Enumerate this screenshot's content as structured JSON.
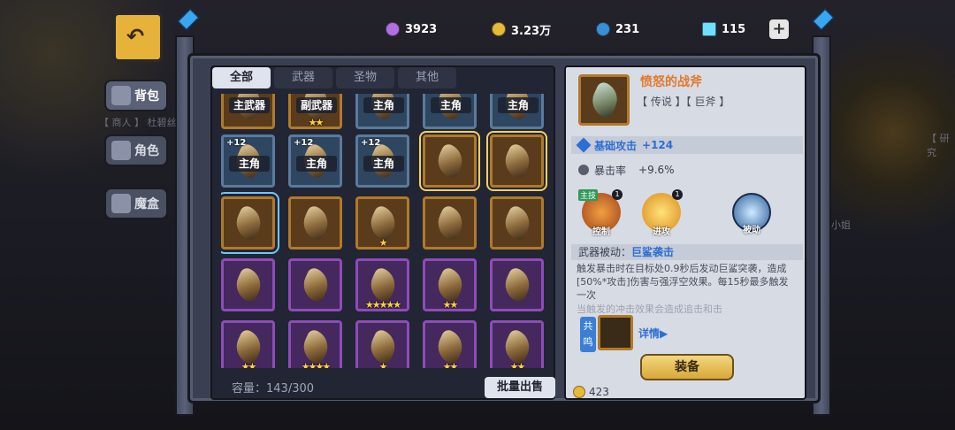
{
  "resources": [
    {
      "name": "purple-orb",
      "value": "3923",
      "color": "#b070e0"
    },
    {
      "name": "gold-coin",
      "value": "3.23万",
      "color": "#e6b93a"
    },
    {
      "name": "blue-orb",
      "value": "231",
      "color": "#3a8fd4"
    },
    {
      "name": "diamond",
      "value": "115",
      "color": "#6fe0ff"
    }
  ],
  "plus_label": "+",
  "nav": {
    "bag": "背包",
    "role": "角色",
    "magic_box": "魔盒"
  },
  "bg_texts": {
    "merchant": "【 商人 】 杜碧丝",
    "research": "【 研究",
    "miss": "小姐"
  },
  "tabs": [
    "全部",
    "武器",
    "圣物",
    "其他"
  ],
  "grid": {
    "row0": [
      {
        "tag": "主武器",
        "lvl": "",
        "stars": "",
        "color": "gold"
      },
      {
        "tag": "副武器",
        "lvl": "",
        "stars": "★★",
        "color": "gold"
      },
      {
        "tag": "主角",
        "lvl": "",
        "stars": "",
        "color": "blue"
      },
      {
        "tag": "主角",
        "lvl": "",
        "stars": "",
        "color": "blue"
      },
      {
        "tag": "主角",
        "lvl": "",
        "stars": "",
        "color": "blue"
      }
    ],
    "row1": [
      {
        "tag": "主角",
        "lvl": "+12",
        "stars": "",
        "color": "blue"
      },
      {
        "tag": "主角",
        "lvl": "+12",
        "stars": "",
        "color": "blue"
      },
      {
        "tag": "主角",
        "lvl": "+12",
        "stars": "",
        "color": "blue"
      },
      {
        "tag": "",
        "lvl": "",
        "stars": "",
        "color": "gold"
      },
      {
        "tag": "",
        "lvl": "",
        "stars": "",
        "color": "gold"
      }
    ],
    "row2": [
      {
        "tag": "",
        "lvl": "",
        "stars": "",
        "color": "gold"
      },
      {
        "tag": "",
        "lvl": "",
        "stars": "",
        "color": "gold"
      },
      {
        "tag": "",
        "lvl": "",
        "stars": "★",
        "color": "gold"
      },
      {
        "tag": "",
        "lvl": "",
        "stars": "",
        "color": "gold"
      },
      {
        "tag": "",
        "lvl": "",
        "stars": "",
        "color": "gold"
      }
    ],
    "row3": [
      {
        "tag": "",
        "lvl": "",
        "stars": "",
        "color": "purple"
      },
      {
        "tag": "",
        "lvl": "",
        "stars": "",
        "color": "purple"
      },
      {
        "tag": "",
        "lvl": "",
        "stars": "★★★★★",
        "color": "purple"
      },
      {
        "tag": "",
        "lvl": "",
        "stars": "★★",
        "color": "purple"
      },
      {
        "tag": "",
        "lvl": "",
        "stars": "",
        "color": "purple"
      }
    ],
    "row4": [
      {
        "tag": "",
        "lvl": "",
        "stars": "★★",
        "color": "purple"
      },
      {
        "tag": "",
        "lvl": "",
        "stars": "★★★★",
        "color": "purple"
      },
      {
        "tag": "",
        "lvl": "",
        "stars": "★",
        "color": "purple"
      },
      {
        "tag": "",
        "lvl": "",
        "stars": "★★",
        "color": "purple"
      },
      {
        "tag": "",
        "lvl": "",
        "stars": "★★",
        "color": "purple"
      }
    ]
  },
  "capacity": "容量：143/300",
  "batch_sell": "批量出售",
  "detail": {
    "name": "愤怒的战斧",
    "type": "【 传说 】【 巨斧 】",
    "stat1_label": "基础攻击",
    "stat1_value": "+124",
    "stat2_label": "暴击率",
    "stat2_value": "+9.6%",
    "skills": [
      {
        "label": "控制",
        "badge": "1",
        "main": "主技"
      },
      {
        "label": "进攻",
        "badge": "1",
        "main": ""
      },
      {
        "label": "被动",
        "badge": "",
        "main": ""
      }
    ],
    "passive_prefix": "武器被动：",
    "passive_name": "巨鲨袭击",
    "desc": "触发暴击时在目标处0.9秒后发动巨鲨突袭，造成[50%*攻击]伤害与强浮空效果。每15秒最多触发一次",
    "desc_fade": "当触发的冲击效果会造成追击和击",
    "resonance": "共鸣",
    "details_label": "详情",
    "equip_label": "装备",
    "coin": "423"
  }
}
